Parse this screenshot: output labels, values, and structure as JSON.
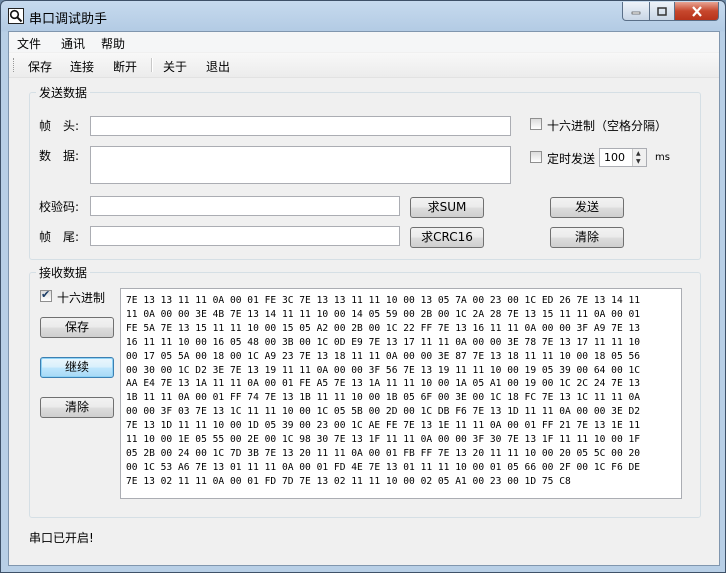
{
  "window": {
    "title": "串口调试助手",
    "icon": "magnifier-app-icon"
  },
  "menu": [
    "文件",
    "通讯",
    "帮助"
  ],
  "toolbar": [
    "保存",
    "连接",
    "断开",
    "关于",
    "退出"
  ],
  "send": {
    "group_title": "发送数据",
    "header_label": "帧　头:",
    "data_label": "数　据:",
    "checksum_label": "校验码:",
    "footer_label": "帧　尾:",
    "header_value": "",
    "data_value": "",
    "checksum_value": "",
    "footer_value": "",
    "hex_checkbox": {
      "label": "十六进制（空格分隔）",
      "checked": false
    },
    "timer_checkbox": {
      "label": "定时发送",
      "checked": false
    },
    "interval": "100",
    "interval_unit": "ms",
    "sum_button": "求SUM",
    "crc_button": "求CRC16",
    "send_button": "发送",
    "clear_button": "清除"
  },
  "receive": {
    "group_title": "接收数据",
    "hex_checkbox": {
      "label": "十六进制",
      "checked": true
    },
    "save_button": "保存",
    "continue_button": "继续",
    "clear_button": "清除",
    "lines": [
      "7E 13 13 11 11 0A 00 01 FE 3C 7E 13 13 11 11 10 00 13 05 7A 00 23 00 1C ED 26 7E 13 14 11",
      "11 0A 00 00 3E 4B 7E 13 14 11 11 10 00 14 05 59 00 2B 00 1C 2A 28 7E 13 15 11 11 0A 00 01",
      "FE 5A 7E 13 15 11 11 10 00 15 05 A2 00 2B 00 1C 22 FF 7E 13 16 11 11 0A 00 00 3F A9 7E 13",
      "16 11 11 10 00 16 05 48 00 3B 00 1C 0D E9 7E 13 17 11 11 0A 00 00 3E 78 7E 13 17 11 11 10",
      "00 17 05 5A 00 18 00 1C A9 23 7E 13 18 11 11 0A 00 00 3E 87 7E 13 18 11 11 10 00 18 05 56",
      "00 30 00 1C D2 3E 7E 13 19 11 11 0A 00 00 3F 56 7E 13 19 11 11 10 00 19 05 39 00 64 00 1C",
      "AA E4 7E 13 1A 11 11 0A 00 01 FE A5 7E 13 1A 11 11 10 00 1A 05 A1 00 19 00 1C 2C 24 7E 13",
      "1B 11 11 0A 00 01 FF 74 7E 13 1B 11 11 10 00 1B 05 6F 00 3E 00 1C 18 FC 7E 13 1C 11 11 0A",
      "00 00 3F 03 7E 13 1C 11 11 10 00 1C 05 5B 00 2D 00 1C DB F6 7E 13 1D 11 11 0A 00 00 3E D2",
      "7E 13 1D 11 11 10 00 1D 05 39 00 23 00 1C AE FE 7E 13 1E 11 11 0A 00 01 FF 21 7E 13 1E 11",
      "11 10 00 1E 05 55 00 2E 00 1C 98 30 7E 13 1F 11 11 0A 00 00 3F 30 7E 13 1F 11 11 10 00 1F",
      "05 2B 00 24 00 1C 7D 3B 7E 13 20 11 11 0A 00 01 FB FF 7E 13 20 11 11 10 00 20 05 5C 00 20",
      "00 1C 53 A6 7E 13 01 11 11 0A 00 01 FD 4E 7E 13 01 11 11 10 00 01 05 66 00 2F 00 1C F6 DE",
      "7E 13 02 11 11 0A 00 01 FD 7D 7E 13 02 11 11 10 00 02 05 A1 00 23 00 1D 75 C8"
    ]
  },
  "status": "串口已开启!"
}
